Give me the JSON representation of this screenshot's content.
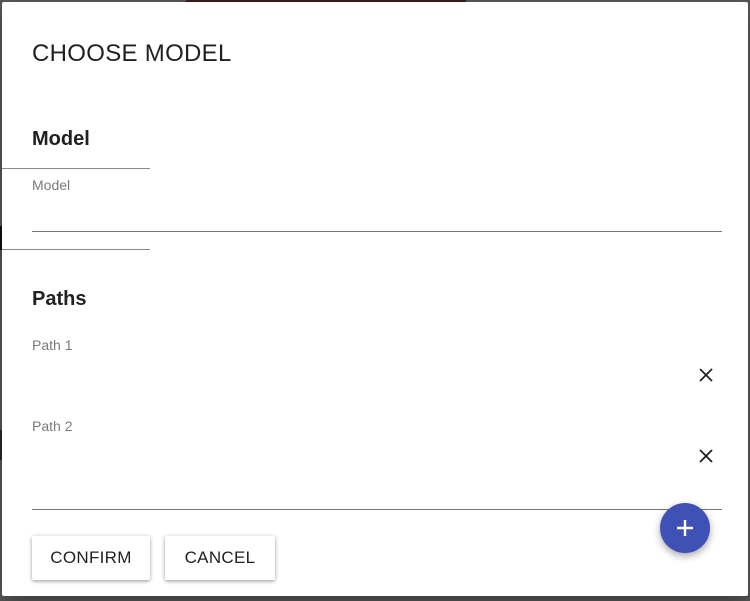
{
  "dialog": {
    "title": "CHOOSE MODEL"
  },
  "model_section": {
    "heading": "Model",
    "field": {
      "label": "Model",
      "value": ""
    }
  },
  "paths_section": {
    "heading": "Paths",
    "fields": [
      {
        "label": "Path 1",
        "value": "",
        "clear_icon": "close-icon"
      },
      {
        "label": "Path 2",
        "value": "",
        "clear_icon": "close-icon"
      }
    ],
    "add_icon": "plus-icon"
  },
  "actions": {
    "confirm_label": "CONFIRM",
    "cancel_label": "CANCEL"
  },
  "colors": {
    "accent": "#3f51b5",
    "text": "#212121",
    "label": "#7a7a7a"
  }
}
